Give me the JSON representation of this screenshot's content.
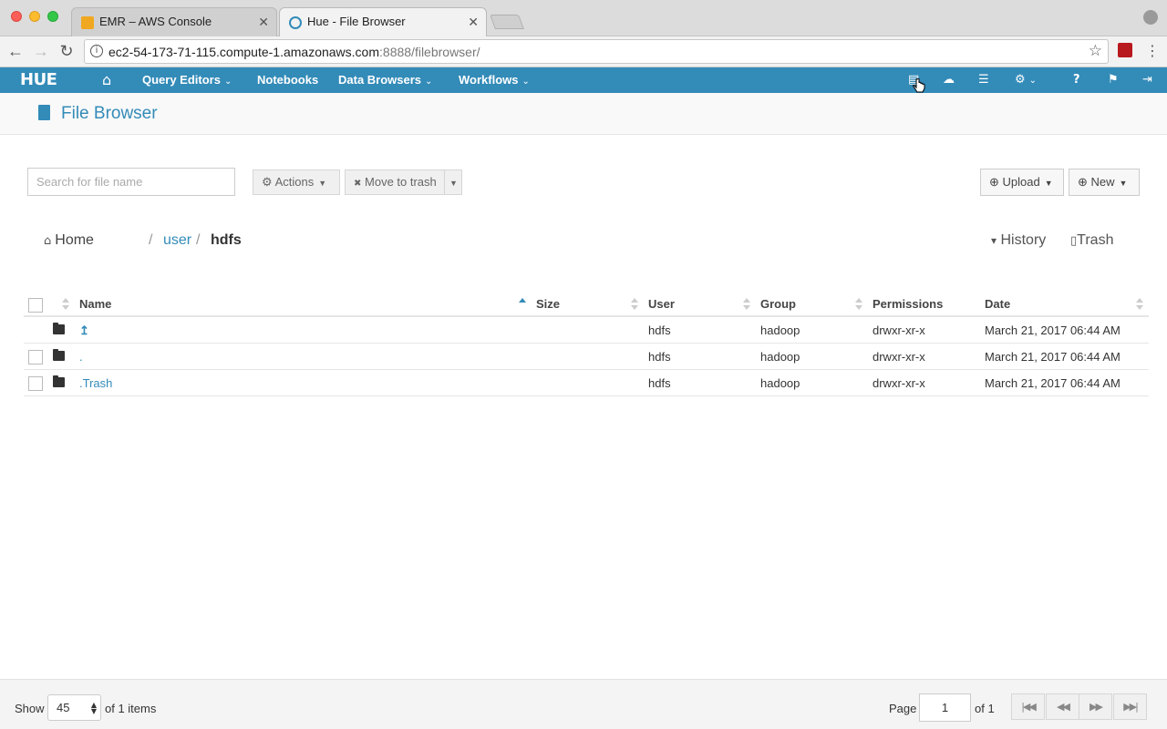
{
  "browser": {
    "tabs": [
      {
        "label": "EMR – AWS Console",
        "close": "✕",
        "active": false
      },
      {
        "label": "Hue - File Browser",
        "close": "✕",
        "active": true
      }
    ],
    "url_host": "ec2-54-173-71-115.compute-1.amazonaws.com",
    "url_rest": ":8888/filebrowser/",
    "back": "←",
    "forward": "→",
    "reload": "↻",
    "star": "☆",
    "menu": "⋮",
    "info": "i"
  },
  "hue": {
    "logo": "HUE",
    "nav": {
      "home_icon": "⌂",
      "query_editors": "Query Editors",
      "notebooks": "Notebooks",
      "data_browsers": "Data Browsers",
      "workflows": "Workflows",
      "chevron": "⌄"
    },
    "icons": {
      "file": "▤",
      "cloud": "☁",
      "table": "☰",
      "gears": "⚙",
      "help": "?",
      "flag": "⚑",
      "logout": "⇥"
    }
  },
  "page": {
    "title": "File Browser"
  },
  "toolbar": {
    "search_placeholder": "Search for file name",
    "actions": "Actions",
    "move_to_trash": "Move to trash",
    "upload": "Upload",
    "new": "New",
    "actions_icon": "⚙",
    "trash_x": "✖",
    "upload_icon": "⊕",
    "new_icon": "⊕"
  },
  "breadcrumb": {
    "home": "Home",
    "sep": "/",
    "user": "user",
    "current": "hdfs",
    "history": "History",
    "trash": "Trash",
    "history_caret": "▾",
    "trash_icon": "🗑",
    "home_icon": "⌂"
  },
  "table": {
    "columns": [
      "Name",
      "Size",
      "User",
      "Group",
      "Permissions",
      "Date"
    ],
    "rows": [
      {
        "name": "↥",
        "size": "",
        "user": "hdfs",
        "group": "hadoop",
        "permissions": "drwxr-xr-x",
        "date": "March 21, 2017 06:44 AM"
      },
      {
        "name": ".",
        "size": "",
        "user": "hdfs",
        "group": "hadoop",
        "permissions": "drwxr-xr-x",
        "date": "March 21, 2017 06:44 AM"
      },
      {
        "name": ".Trash",
        "size": "",
        "user": "hdfs",
        "group": "hadoop",
        "permissions": "drwxr-xr-x",
        "date": "March 21, 2017 06:44 AM"
      }
    ]
  },
  "footer": {
    "show": "Show",
    "page_size": "45",
    "of_items": "of 1 items",
    "page": "Page",
    "page_num": "1",
    "of_pages": "of 1",
    "first": "⏮",
    "prev": "⏪",
    "next": "⏩",
    "last": "⏭",
    "select_arrows": "▲▼"
  },
  "colors": {
    "accent": "#338bb8",
    "nav_bg": "#338bb8"
  }
}
